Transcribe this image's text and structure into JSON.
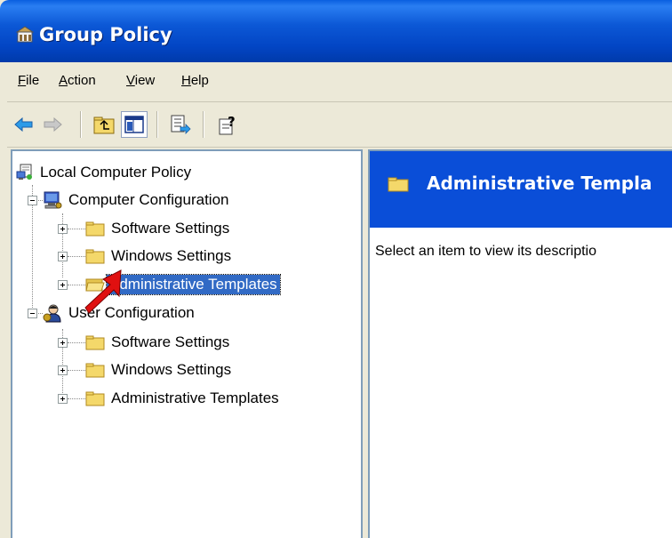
{
  "window": {
    "title": "Group Policy"
  },
  "menu": [
    {
      "label": "File",
      "mnemonic": "F",
      "rest": "ile"
    },
    {
      "label": "Action",
      "mnemonic": "A",
      "rest": "ction"
    },
    {
      "label": "View",
      "mnemonic": "V",
      "rest": "iew"
    },
    {
      "label": "Help",
      "mnemonic": "H",
      "rest": "elp"
    }
  ],
  "toolbar": {
    "buttons": [
      "back-arrow-icon",
      "forward-arrow-icon",
      "up-one-level-icon",
      "show-hide-console-tree-icon",
      "export-list-icon",
      "help-icon"
    ]
  },
  "tree": {
    "root": {
      "label": "Local Computer Policy"
    },
    "computer_config": {
      "label": "Computer Configuration",
      "children": [
        {
          "label": "Software Settings"
        },
        {
          "label": "Windows Settings"
        },
        {
          "label": "Administrative Templates",
          "selected": true
        }
      ]
    },
    "user_config": {
      "label": "User Configuration",
      "children": [
        {
          "label": "Software Settings"
        },
        {
          "label": "Windows Settings"
        },
        {
          "label": "Administrative Templates"
        }
      ]
    }
  },
  "details": {
    "title": "Administrative Templa",
    "description": "Select an item to view its descriptio"
  },
  "colors": {
    "titlebar": "#0245c4",
    "selection": "#316ac5",
    "header": "#0a4ed8",
    "folder": "#f4d86a",
    "arrow": "#e01010"
  }
}
